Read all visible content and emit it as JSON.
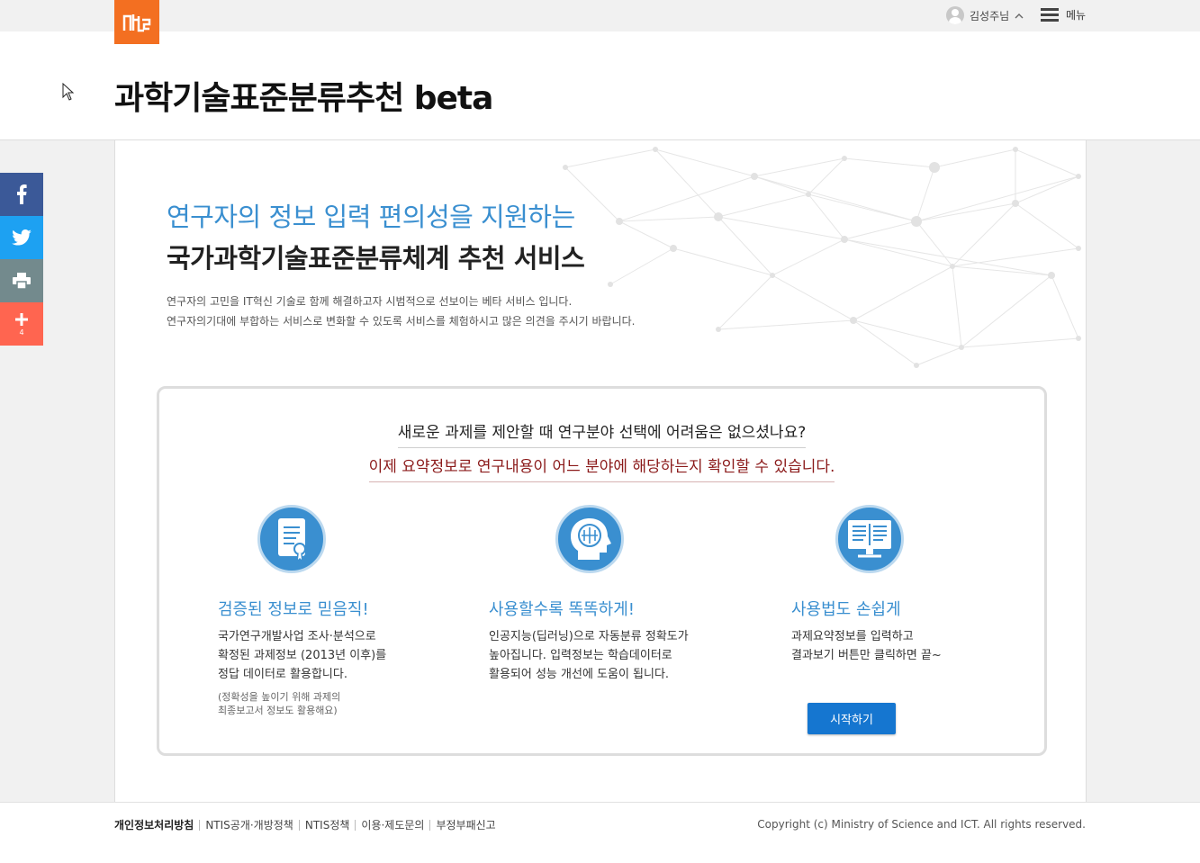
{
  "header": {
    "title": "과학기술표준분류추천 beta",
    "user_name": "김성주님",
    "menu_label": "메뉴"
  },
  "share": {
    "plus_count": "4"
  },
  "hero": {
    "headline_line1": "연구자의 정보 입력 편의성을 지원하는",
    "headline_line2": "국가과학기술표준분류체계 추천 서비스",
    "intro_line1": "연구자의 고민을 IT혁신 기술로 함께 해결하고자 시범적으로 선보이는 베타 서비스 입니다.",
    "intro_line2": "연구자의기대에 부합하는 서비스로 변화할 수 있도록 서비스를 체험하시고 많은 의견을 주시기 바랍니다."
  },
  "card": {
    "question": "새로운 과제를 제안할 때 연구분야 선택에 어려움은 없으셨나요?",
    "answer": "이제 요약정보로 연구내용이 어느 분야에 해당하는지 확인할 수 있습니다.",
    "features": [
      {
        "title": "검증된 정보로 믿음직!",
        "desc_lines": [
          "국가연구개발사업 조사·분석으로",
          "확정된 과제정보 (2013년 이후)를",
          "정답 데이터로 활용합니다."
        ],
        "note_lines": [
          "(정확성을 높이기 위해 과제의",
          "최종보고서 정보도 활용해요)"
        ],
        "icon": "document-certificate-icon"
      },
      {
        "title": "사용할수록 똑똑하게!",
        "desc_lines": [
          "인공지능(딥러닝)으로 자동분류 정확도가",
          "높아집니다. 입력정보는 학습데이터로",
          "활용되어 성능 개선에 도움이 됩니다."
        ],
        "icon": "ai-brain-head-icon"
      },
      {
        "title": "사용법도 손쉽게",
        "desc_lines": [
          "과제요약정보를 입력하고",
          "결과보기 버튼만 클릭하면 끝~"
        ],
        "button_label": "시작하기",
        "icon": "monitor-book-icon"
      }
    ]
  },
  "footer": {
    "links": [
      "개인정보처리방침",
      "NTIS공개·개방정책",
      "NTIS정책",
      "이용·제도문의",
      "부정부패신고"
    ],
    "copyright": "Copyright (c) Ministry of Science and ICT. All rights reserved."
  },
  "colors": {
    "brand_orange": "#f36f21",
    "accent_blue": "#3a8fd0",
    "button_blue": "#1576d0",
    "answer_red": "#8b1a1a",
    "facebook": "#3b5998",
    "twitter": "#1da1f2",
    "print": "#738a8d",
    "plus": "#ff6550"
  }
}
